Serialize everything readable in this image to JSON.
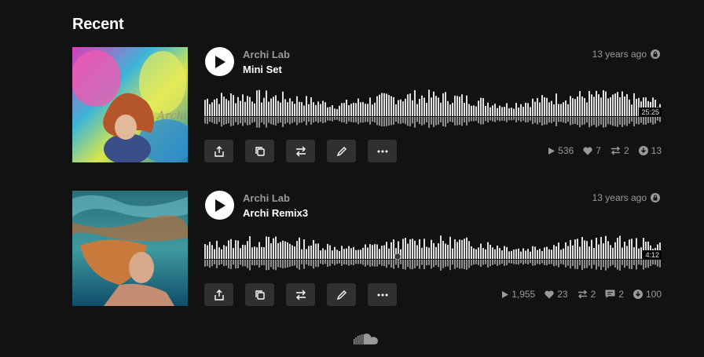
{
  "section": {
    "title": "Recent"
  },
  "tracks": [
    {
      "artist": "Archi Lab",
      "title": "Mini Set",
      "posted": "13 years ago",
      "duration": "25:25",
      "stats": {
        "plays": "536",
        "likes": "7",
        "reposts": "2",
        "downloads": "13"
      }
    },
    {
      "artist": "Archi Lab",
      "title": "Archi Remix3",
      "posted": "13 years ago",
      "duration": "4:12",
      "stats": {
        "plays": "1,955",
        "likes": "23",
        "reposts": "2",
        "comments": "2",
        "downloads": "100"
      }
    }
  ],
  "icons": {
    "play": "play-icon",
    "lock": "lock-icon",
    "share": "share-icon",
    "copy": "copy-icon",
    "repost": "repost-icon",
    "edit": "pencil-icon",
    "more": "more-icon",
    "heart": "heart-icon",
    "download": "download-icon",
    "comment": "comment-icon",
    "logo": "soundcloud-icon"
  },
  "colors": {
    "background": "#121212",
    "muted": "#9a9a9a",
    "button": "#303030",
    "wave": "#e0e0e0"
  }
}
